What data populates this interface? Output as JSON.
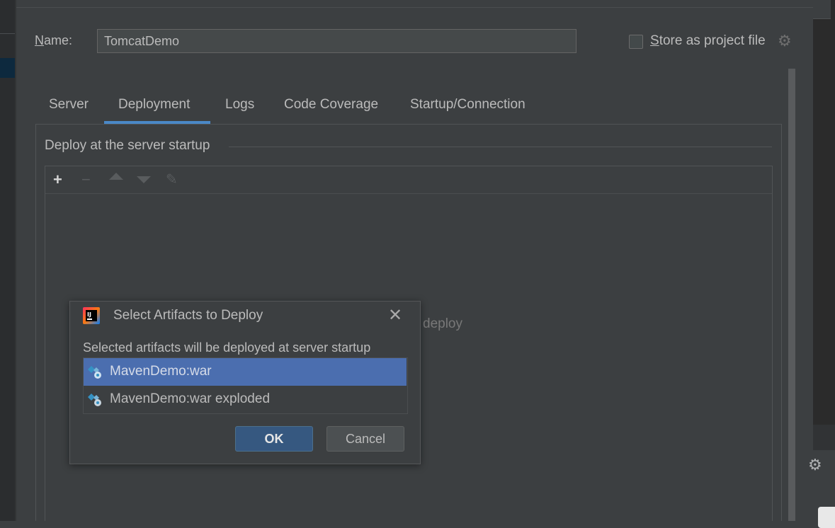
{
  "name_field": {
    "label_prefix": "N",
    "label_rest": "ame:",
    "value": "TomcatDemo"
  },
  "store_option": {
    "label_prefix": "S",
    "label_rest": "tore as project file",
    "checked": false
  },
  "tabs": [
    {
      "label": "Server"
    },
    {
      "label": "Deployment",
      "active": true
    },
    {
      "label": "Logs"
    },
    {
      "label": "Code Coverage"
    },
    {
      "label": "Startup/Connection"
    }
  ],
  "deploy_section": {
    "title": "Deploy at the server startup",
    "empty_hint_fragment": "deploy",
    "toolbar_icons": [
      "add-icon",
      "remove-icon",
      "move-up-icon",
      "move-down-icon",
      "edit-icon"
    ]
  },
  "dialog": {
    "title": "Select Artifacts to Deploy",
    "subtitle": "Selected artifacts will be deployed at server startup",
    "artifacts": [
      {
        "label": "MavenDemo:war",
        "selected": true
      },
      {
        "label": "MavenDemo:war exploded",
        "selected": false
      }
    ],
    "ok_label": "OK",
    "cancel_label": "Cancel"
  },
  "colors": {
    "background": "#3c3f41",
    "selection": "#4b6eaf",
    "tab_underline": "#4a88c7",
    "ok_button": "#365880"
  }
}
